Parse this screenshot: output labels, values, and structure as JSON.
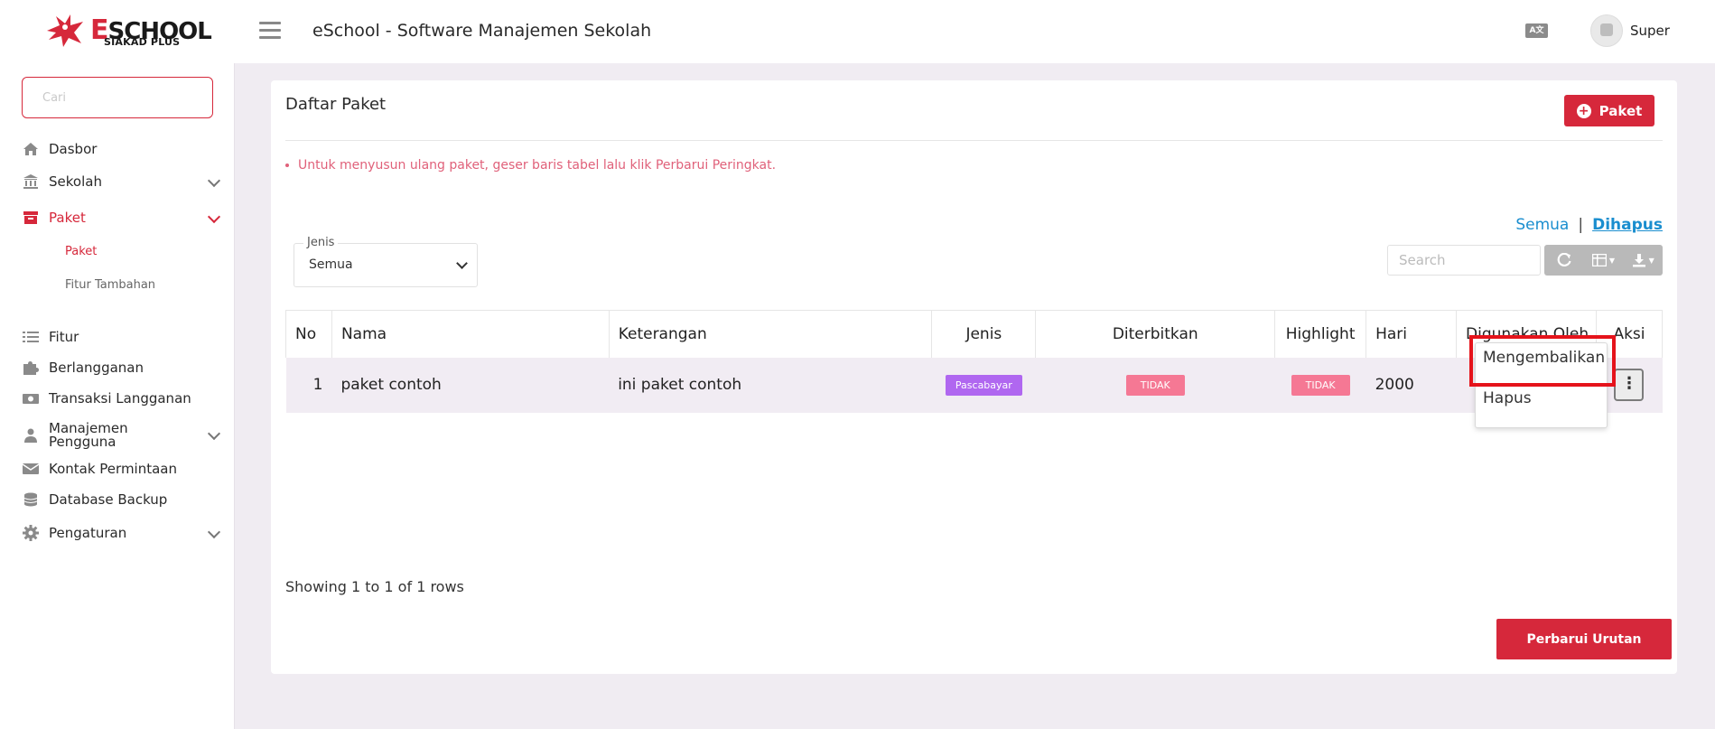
{
  "brand": {
    "name": "ESCHOOL",
    "first_letter": "E",
    "rest": "SCHOOL",
    "tagline": "SIAKAD PLUS"
  },
  "header": {
    "title": "eSchool - Software Manajemen Sekolah",
    "language_icon": "A文",
    "user_name": "Super"
  },
  "sidebar": {
    "search_placeholder": "Cari",
    "items": [
      {
        "label": "Dasbor",
        "icon": "home-icon"
      },
      {
        "label": "Sekolah",
        "icon": "bank-icon",
        "expandable": true
      },
      {
        "label": "Paket",
        "icon": "archive-icon",
        "expandable": true,
        "active": true
      },
      {
        "label": "Fitur",
        "icon": "list-icon"
      },
      {
        "label": "Berlangganan",
        "icon": "puzzle-icon"
      },
      {
        "label": "Transaksi Langganan",
        "icon": "money-icon"
      },
      {
        "label": "Manajemen Pengguna",
        "icon": "users-icon",
        "expandable": true
      },
      {
        "label": "Kontak Permintaan",
        "icon": "mail-icon"
      },
      {
        "label": "Database Backup",
        "icon": "database-icon"
      },
      {
        "label": "Pengaturan",
        "icon": "gear-icon",
        "expandable": true
      }
    ],
    "sub_items": [
      {
        "label": "Paket",
        "active": true
      },
      {
        "label": "Fitur Tambahan"
      }
    ]
  },
  "main": {
    "title": "Daftar Paket",
    "add_button_label": "Paket",
    "note": "Untuk menyusun ulang paket, geser baris tabel lalu klik Perbarui Peringkat.",
    "filter_links": {
      "all": "Semua",
      "separator": "|",
      "deleted": "Dihapus"
    },
    "filter_jenis": {
      "label": "Jenis",
      "value": "Semua"
    },
    "search_placeholder": "Search",
    "table": {
      "columns": [
        "No",
        "Nama",
        "Keterangan",
        "Jenis",
        "Diterbitkan",
        "Highlight",
        "Hari",
        "Digunakan Oleh",
        "Aksi"
      ],
      "rows": [
        {
          "no": "1",
          "nama": "paket contoh",
          "keterangan": "ini paket contoh",
          "jenis": "Pascabayar",
          "diterbitkan": "TIDAK",
          "highlight": "TIDAK",
          "hari": "2000"
        }
      ]
    },
    "action_menu": [
      "Mengembalikan",
      "Hapus"
    ],
    "showing_text": "Showing 1 to 1 of 1 rows",
    "order_button_label": "Perbarui Urutan"
  },
  "colors": {
    "accent": "#d6283b",
    "link": "#1a8ecf",
    "badge_purple": "#b067f0",
    "badge_pink": "#f57894",
    "highlight_red": "#e5131b"
  }
}
